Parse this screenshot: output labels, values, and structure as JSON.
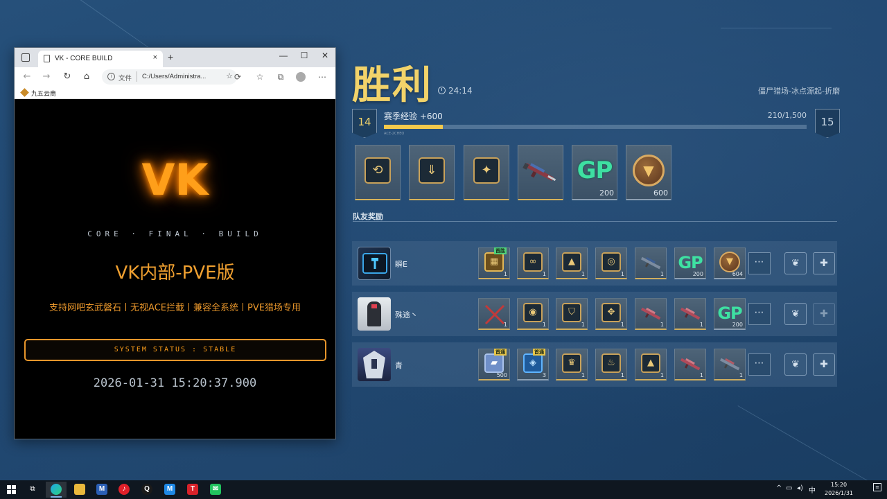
{
  "browser": {
    "tab_title": "VK - CORE BUILD",
    "tab_close": "×",
    "new_tab": "+",
    "win_minimize": "—",
    "win_maximize": "☐",
    "win_close": "✕",
    "address_scheme": "文件",
    "address_url": "C:/Users/Administra...",
    "favorites": [
      {
        "label": "九五云商"
      }
    ]
  },
  "vk_page": {
    "logo": "VK",
    "subtitle": "CORE · FINAL · BUILD",
    "title": "VK内部-PVE版",
    "description": "支持网吧玄武磐石丨无视ACE拦截丨兼容全系统丨PVE猎场专用",
    "status": "SYSTEM STATUS : STABLE",
    "timestamp": "2026-01-31 15:20:37.900",
    "logo_color": "#ff9f1a",
    "accent_color": "#e8962b"
  },
  "result": {
    "title": "胜利",
    "duration": "24:14",
    "map": "僵尸猎场-冰点源起-折磨",
    "level_current": "14",
    "level_next": "15",
    "xp_label": "赛季经验 +600",
    "xp_count": "210/1,500",
    "xp_progress": 0.14,
    "xp_caption": "ACE-2CHEO",
    "title_color": "#f2d36a",
    "rewards": [
      {
        "icon": "loot-crate-icon",
        "qty": ""
      },
      {
        "icon": "weapon-upgrade-icon",
        "qty": ""
      },
      {
        "icon": "armor-mod-icon",
        "qty": ""
      },
      {
        "icon": "assault-rifle-icon",
        "qty": ""
      },
      {
        "icon": "gp-icon",
        "text": "GP",
        "qty": "200"
      },
      {
        "icon": "honor-coin-icon",
        "qty": "600"
      }
    ]
  },
  "team": {
    "label": "队友奖励",
    "members": [
      {
        "name": "瞬E",
        "items": [
          {
            "icon": "gold-crate-icon",
            "qty": "1",
            "tag": "首胜"
          },
          {
            "icon": "weapon-part-icon",
            "qty": "1"
          },
          {
            "icon": "emblem-icon",
            "qty": "1"
          },
          {
            "icon": "module-icon",
            "qty": "1"
          },
          {
            "icon": "rifle-icon",
            "qty": "1"
          },
          {
            "icon": "gp-icon",
            "text": "GP",
            "qty": "200"
          },
          {
            "icon": "honor-coin-icon",
            "qty": "604"
          }
        ],
        "more": "⋯"
      },
      {
        "name": "殊途丶",
        "items": [
          {
            "icon": "crossed-blades-icon",
            "qty": "1"
          },
          {
            "icon": "target-module-icon",
            "qty": "1"
          },
          {
            "icon": "shield-module-icon",
            "qty": "1"
          },
          {
            "icon": "core-module-icon",
            "qty": "1"
          },
          {
            "icon": "red-rifle-icon",
            "qty": "1"
          },
          {
            "icon": "red-rifle-icon",
            "qty": "1"
          },
          {
            "icon": "gp-icon",
            "text": "GP",
            "qty": "200"
          }
        ],
        "more": "⋯"
      },
      {
        "name": "青",
        "items": [
          {
            "icon": "ticket-icon",
            "qty": "500",
            "tag": "首通"
          },
          {
            "icon": "blue-cube-icon",
            "qty": "3",
            "tag": "首通"
          },
          {
            "icon": "crown-module-icon",
            "qty": "1"
          },
          {
            "icon": "flame-module-icon",
            "qty": "1"
          },
          {
            "icon": "peak-module-icon",
            "qty": "1"
          },
          {
            "icon": "red-rifle-icon",
            "qty": "1"
          },
          {
            "icon": "rifle-icon",
            "qty": "1"
          }
        ],
        "more": "⋯"
      }
    ]
  },
  "taskbar": {
    "apps": [
      {
        "icon": "edge-browser-icon",
        "active": true
      },
      {
        "icon": "file-explorer-icon"
      },
      {
        "icon": "app-ms-icon"
      },
      {
        "icon": "netease-music-icon"
      },
      {
        "icon": "qq-icon"
      },
      {
        "icon": "app-blue-icon"
      },
      {
        "icon": "app-red-icon"
      },
      {
        "icon": "wechat-icon"
      }
    ],
    "ime": "中",
    "time": "15:20",
    "date": "2026/1/31"
  }
}
